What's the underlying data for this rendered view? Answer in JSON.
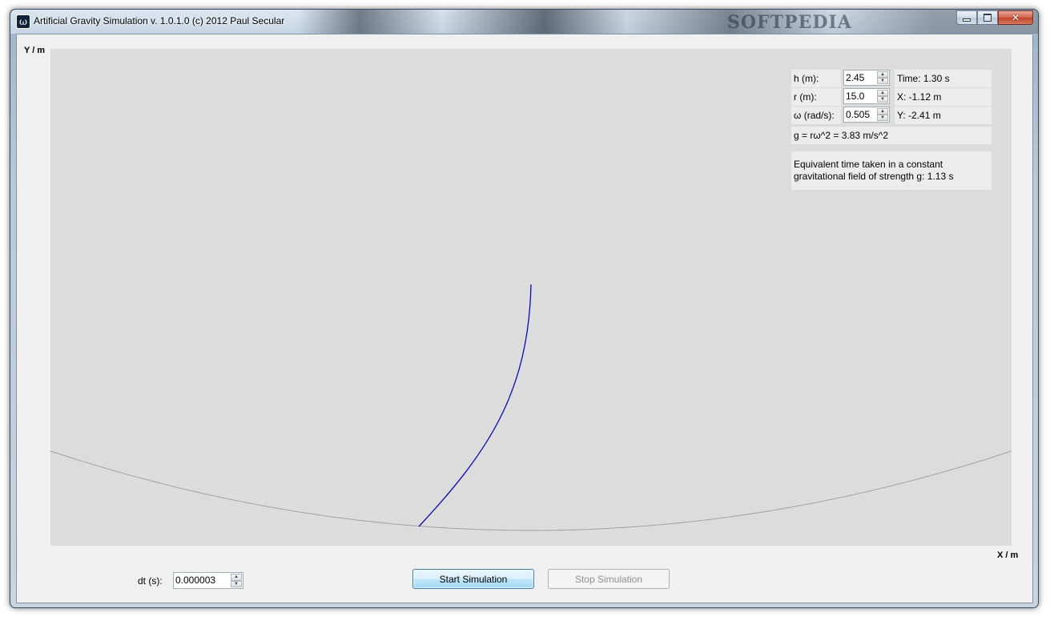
{
  "window": {
    "title": "Artificial Gravity Simulation v. 1.0.1.0 (c) 2012 Paul Secular",
    "icon_glyph": "ω",
    "watermark": "SOFTPEDIA"
  },
  "axes": {
    "y_label": "Y / m",
    "x_label": "X / m"
  },
  "params": {
    "h_label": "h (m):",
    "h_value": "2.45",
    "r_label": "r (m):",
    "r_value": "15.0",
    "omega_label": "ω (rad/s):",
    "omega_value": "0.505",
    "time": "Time: 1.30 s",
    "x_pos": "X: -1.12 m",
    "y_pos": "Y: -2.41 m",
    "g_formula": "g = rω^2 = 3.83 m/s^2",
    "equiv_line1": "Equivalent time taken in a constant",
    "equiv_line2": "gravitational field of strength g: 1.13 s"
  },
  "controls": {
    "dt_label": "dt (s):",
    "dt_value": "0.000003",
    "start_label": "Start Simulation",
    "stop_label": "Stop Simulation"
  },
  "colors": {
    "trajectory": "#0a0ab4",
    "floor_arc": "#a0a0a0",
    "canvas_bg": "#dcdcdc"
  }
}
